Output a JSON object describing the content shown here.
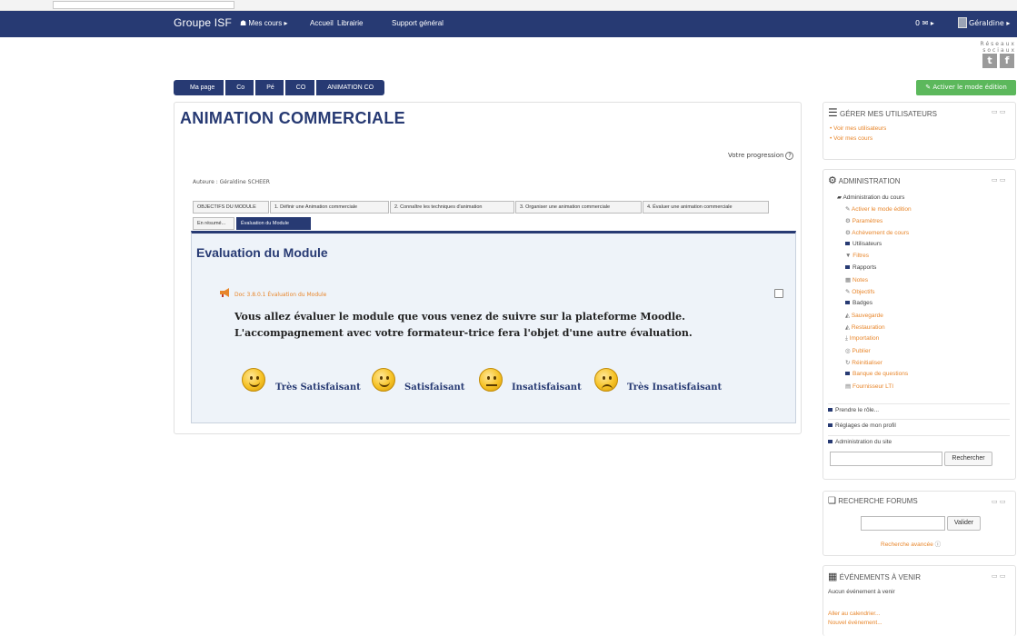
{
  "navbar": {
    "brand": "Groupe ISF",
    "items": [
      "Mes cours ▸",
      "Accueil",
      "Librairie",
      "Support général"
    ],
    "messages": "0 ✉ ▸",
    "user": "Géraldine ▸"
  },
  "social": {
    "label": "Réseaux sociaux"
  },
  "breadcrumb": [
    "Ma page",
    "Co",
    "Pé",
    "CO",
    "ANIMATION CO"
  ],
  "edit_button": "Activer le mode édition",
  "course": {
    "title": "ANIMATION COMMERCIALE",
    "progress_label": "Votre progression",
    "author": "Auteure : Géraldine SCHEER"
  },
  "tabs_row1": [
    "OBJECTIFS DU MODULE",
    "1. Définir une Animation commerciale",
    "2. Connaître les techniques d'animation",
    "3. Organiser une animation commerciale",
    "4. Évaluer une animation commerciale"
  ],
  "tabs_row2": [
    "En résumé...",
    "Évaluation du Module"
  ],
  "module": {
    "title": "Evaluation du Module",
    "doc_link": "Doc 3.8.0.1 Évaluation du Module",
    "message_line1": "Vous allez évaluer le module que vous venez de suivre sur la plateforme Moodle.",
    "message_line2": "L'accompagnement avec votre formateur-trice fera l'objet d'une autre évaluation.",
    "ratings": [
      "Très Satisfaisant",
      "Satisfaisant",
      "Insatisfaisant",
      "Très Insatisfaisant"
    ]
  },
  "users_block": {
    "title": "GÉRER MES UTILISATEURS",
    "links": [
      "Voir mes utilisateurs",
      "Voir mes cours"
    ]
  },
  "admin_block": {
    "title": "ADMINISTRATION",
    "course_admin": "Administration du cours",
    "items": [
      "Activer le mode édition",
      "Paramètres",
      "Achèvement de cours",
      "Utilisateurs",
      "Filtres",
      "Rapports",
      "Notes",
      "Objectifs",
      "Badges",
      "Sauvegarde",
      "Restauration",
      "Importation",
      "Publier",
      "Réinitialiser",
      "Banque de questions",
      "Fournisseur LTI"
    ],
    "role": "Prendre le rôle...",
    "profile": "Réglages de mon profil",
    "site_admin": "Administration du site",
    "search_button": "Rechercher"
  },
  "forum_block": {
    "title": "RECHERCHE FORUMS",
    "submit": "Valider",
    "advanced": "Recherche avancée"
  },
  "events_block": {
    "title": "ÉVÉNEMENTS À VENIR",
    "none": "Aucun événement à venir",
    "calendar": "Aller au calendrier...",
    "new_event": "Nouvel événement..."
  },
  "colors": {
    "primary": "#273a73",
    "accent": "#e8862b",
    "success": "#5cb85c"
  }
}
